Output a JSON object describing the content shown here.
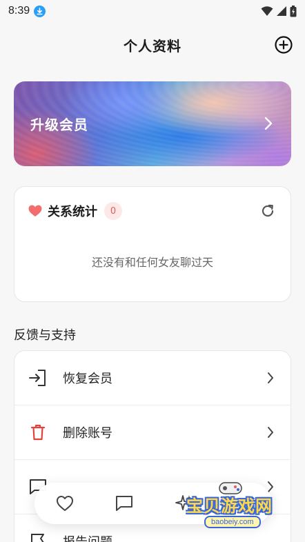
{
  "status_bar": {
    "time": "8:39",
    "icons": [
      "download-icon",
      "wifi-icon",
      "signal-icon",
      "battery-charging-icon"
    ]
  },
  "header": {
    "title": "个人资料",
    "action_icon": "add-circle-icon"
  },
  "banner": {
    "label": "升级会员",
    "icon": "chevron-right-icon"
  },
  "stats": {
    "title": "关系统计",
    "badge": "0",
    "empty_text": "还没有和任何女友聊过天",
    "icons": [
      "heart-icon",
      "refresh-icon"
    ],
    "heart_color": "#f26d6d"
  },
  "feedback": {
    "section_title": "反馈与支持",
    "items": [
      {
        "label": "恢复会员",
        "icon": "login-icon"
      },
      {
        "label": "删除账号",
        "icon": "trash-icon"
      },
      {
        "label": "",
        "icon": "message-icon"
      },
      {
        "label": "报告问题",
        "icon": "flag-icon"
      }
    ]
  },
  "bottom_nav": {
    "items": [
      {
        "icon": "heart-outline-icon"
      },
      {
        "icon": "chat-icon"
      },
      {
        "icon": "sparkle-icon"
      }
    ]
  },
  "watermark": {
    "text": "宝贝游戏网",
    "url": "baobeiy.com"
  },
  "colors": {
    "danger": "#e0433b",
    "badge_bg": "#fde8e8",
    "badge_text": "#e25a5a",
    "download_badge": "#2b9ff5"
  }
}
